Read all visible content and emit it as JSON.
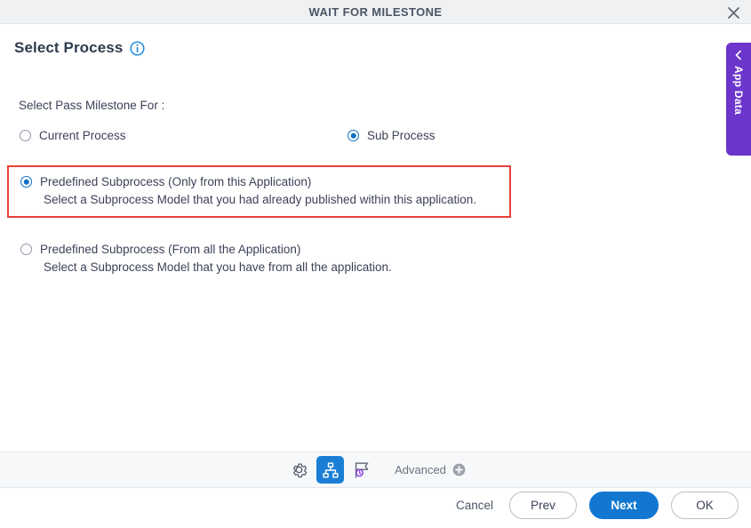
{
  "window": {
    "title": "WAIT FOR MILESTONE",
    "close_icon": "close-icon"
  },
  "header": {
    "title": "Select Process",
    "info_icon": "info-icon"
  },
  "side_tab": {
    "label": "App Data",
    "collapse_icon": "chevron-left-icon",
    "color": "#6c35cc"
  },
  "form": {
    "field_label": "Select Pass Milestone For :",
    "process_type_options": [
      {
        "label": "Current Process",
        "checked": false
      },
      {
        "label": "Sub Process",
        "checked": true
      }
    ],
    "subprocess_options": [
      {
        "label": "Predefined Subprocess (Only from this Application)",
        "description": "Select a Subprocess Model that you had already published within this application.",
        "checked": true,
        "highlighted": true,
        "highlight_color": "#e8413b"
      },
      {
        "label": "Predefined Subprocess (From all the Application)",
        "description": "Select a Subprocess Model that you have from all the application.",
        "checked": false,
        "highlighted": false
      }
    ]
  },
  "toolbar": {
    "buttons": [
      {
        "icon": "gear-icon",
        "name": "settings-tool",
        "active": false
      },
      {
        "icon": "hierarchy-icon",
        "name": "process-tool",
        "active": true
      },
      {
        "icon": "flag-clock-icon",
        "name": "milestone-tool",
        "active": false
      }
    ],
    "advanced_label": "Advanced",
    "advanced_icon": "plus-circle-icon",
    "active_color": "#1a7fd4"
  },
  "actions": {
    "cancel": "Cancel",
    "prev": "Prev",
    "next": "Next",
    "ok": "OK",
    "primary_color": "#1177d1"
  }
}
